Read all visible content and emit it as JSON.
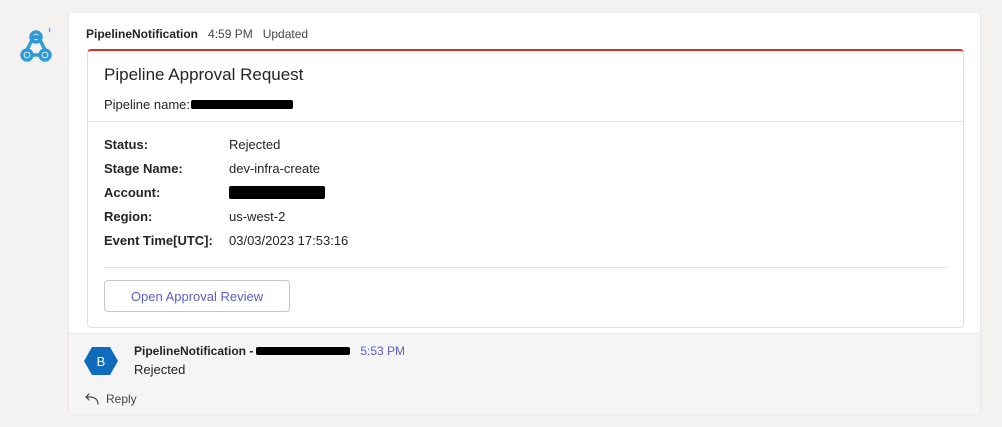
{
  "message": {
    "sender": "PipelineNotification",
    "time": "4:59 PM",
    "edited": "Updated",
    "icon": "webhook-icon"
  },
  "card": {
    "accent_color": "#d92c2c",
    "title": "Pipeline Approval Request",
    "pipeline_label": "Pipeline name:",
    "facts": [
      {
        "key": "Status:",
        "value": "Rejected"
      },
      {
        "key": "Stage Name:",
        "value": "dev-infra-create"
      },
      {
        "key": "Account:",
        "value": ""
      },
      {
        "key": "Region:",
        "value": "us-west-2"
      },
      {
        "key": "Event Time[UTC]:",
        "value": "03/03/2023 17:53:16"
      }
    ],
    "action_label": "Open Approval Review"
  },
  "reply": {
    "avatar_letter": "B",
    "avatar_color": "#0f6cbd",
    "sender": "PipelineNotification -",
    "time": "5:53 PM",
    "text": "Rejected",
    "reply_label": "Reply",
    "reply_icon": "reply-arrow-icon"
  }
}
